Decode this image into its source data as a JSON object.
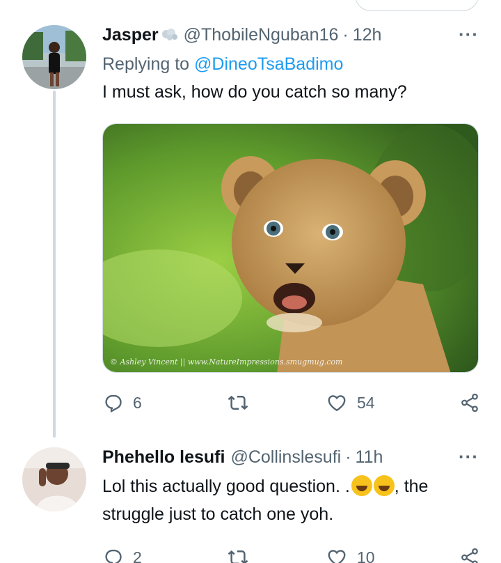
{
  "tweets": [
    {
      "name": "Jasper",
      "handle": "@ThobileNguban16",
      "separator": "·",
      "time": "12h",
      "more": "···",
      "replying_prefix": "Replying to",
      "replying_handle": "@DineoTsaBadimo",
      "text": "I must ask, how do you catch so many?",
      "image": {
        "description_icon": "lion-cub-photo",
        "watermark": "© Ashley Vincent || www.NatureImpressions.smugmug.com"
      },
      "stats": {
        "replies": "6",
        "retweets": "",
        "likes": "54"
      }
    },
    {
      "name": "Phehello lesufi",
      "handle": "@Collinslesufi",
      "separator": "·",
      "time": "11h",
      "more": "···",
      "text_before_emoji": "Lol this actually good question. .",
      "text_after_emoji": ", the",
      "text_line2": "struggle just to catch one yoh.",
      "emoji_icon": "rolling-on-floor-laughing-emoji",
      "stats": {
        "replies": "2",
        "retweets": "",
        "likes": "10"
      }
    }
  ],
  "colors": {
    "accent": "#1d9bf0",
    "secondary_text": "#536471",
    "primary_text": "#0f1419",
    "border": "#cfd9de"
  },
  "icons": [
    "reply-icon",
    "retweet-icon",
    "like-icon",
    "share-icon",
    "more-icon"
  ]
}
